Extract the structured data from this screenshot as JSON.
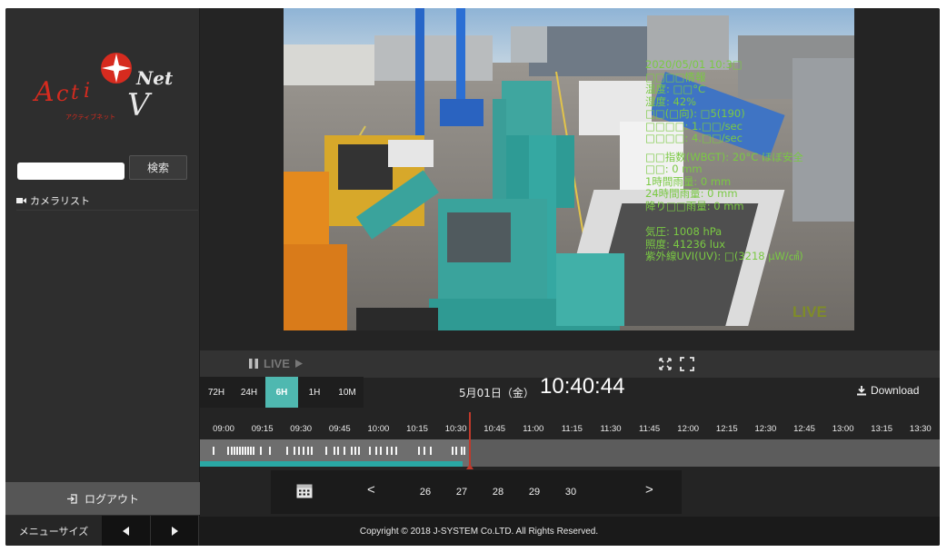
{
  "sidebar": {
    "logo_text": "ActiV Net",
    "logo_sub": "アクティブネット",
    "search_button": "検索",
    "search_placeholder": "",
    "camera_list": "カメラリスト",
    "logout": "ログアウト",
    "menu_size": "メニューサイズ"
  },
  "video": {
    "overlay_lines": [
      "2020/05/01 10:3□",
      "□□□□情報",
      "温度: □□°C",
      "湿度: 42%",
      "□□(□向): □5(190)",
      "□□□□: 1.□□/sec",
      "□□□□: 4.□□/sec",
      "□□指数(WBGT): 20°C ほぼ安全",
      "□□: 0 mm",
      "1時間雨量: 0 mm",
      "24時間雨量: 0 mm",
      "降り□□雨量: 0 mm",
      "気圧: 1008 hPa",
      "照度: 41236 lux",
      "紫外線UVI(UV): □(3218 μW/㎠)"
    ],
    "live_badge": "LIVE"
  },
  "controls": {
    "live_label": "LIVE",
    "range_tabs": [
      "72H",
      "24H",
      "6H",
      "1H",
      "10M"
    ],
    "active_range": "6H",
    "date": "5月01日（金）",
    "time": "10:40:44",
    "download": "Download"
  },
  "timeline": {
    "labels": [
      "09:00",
      "09:15",
      "09:30",
      "09:45",
      "10:00",
      "10:15",
      "10:30",
      "10:45",
      "11:00",
      "11:15",
      "11:30",
      "11:45",
      "12:00",
      "12:15",
      "12:30",
      "12:45",
      "13:00",
      "13:15",
      "13:30"
    ],
    "cursor_time": "10:40:44",
    "progress_fraction": 0.365
  },
  "calendar": {
    "days": [
      "26",
      "27",
      "28",
      "29",
      "30"
    ],
    "prev": "<",
    "next": ">"
  },
  "footer": {
    "copyright": "Copyright © 2018 J-SYSTEM Co.LTD. All Rights Reserved."
  },
  "colors": {
    "accent_teal": "#4fb8b0",
    "overlay_green": "#7ac943",
    "cursor_red": "#c0392b",
    "logo_red": "#d62b1f"
  }
}
